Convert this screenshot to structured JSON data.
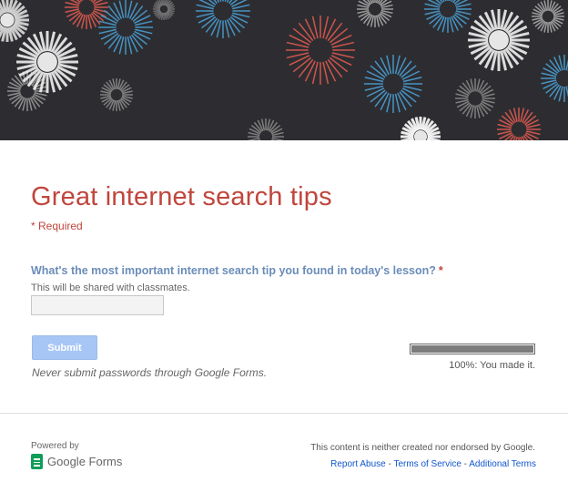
{
  "banner": {
    "image": "fireworks-header"
  },
  "form": {
    "title": "Great internet search tips",
    "required_note": "* Required",
    "question": {
      "text": "What's the most important internet search tip you found in today's lesson?",
      "required_mark": "*",
      "help": "This will be shared with classmates.",
      "value": ""
    },
    "submit_label": "Submit",
    "password_warning": "Never submit passwords through Google Forms.",
    "progress": {
      "percent": 100,
      "label": "100%: You made it."
    }
  },
  "footer": {
    "powered_by": "Powered by",
    "brand": "Google Forms",
    "disclaimer": "This content is neither created nor endorsed by Google.",
    "links": {
      "report": "Report Abuse",
      "sep": " - ",
      "terms": "Terms of Service",
      "additional": "Additional Terms"
    }
  },
  "colors": {
    "title": "#c0463d",
    "question": "#6b8db9",
    "submit": "#a7c6f5",
    "brand_green": "#0f9d58",
    "link": "#1155cc",
    "banner": "#2d2d31"
  }
}
